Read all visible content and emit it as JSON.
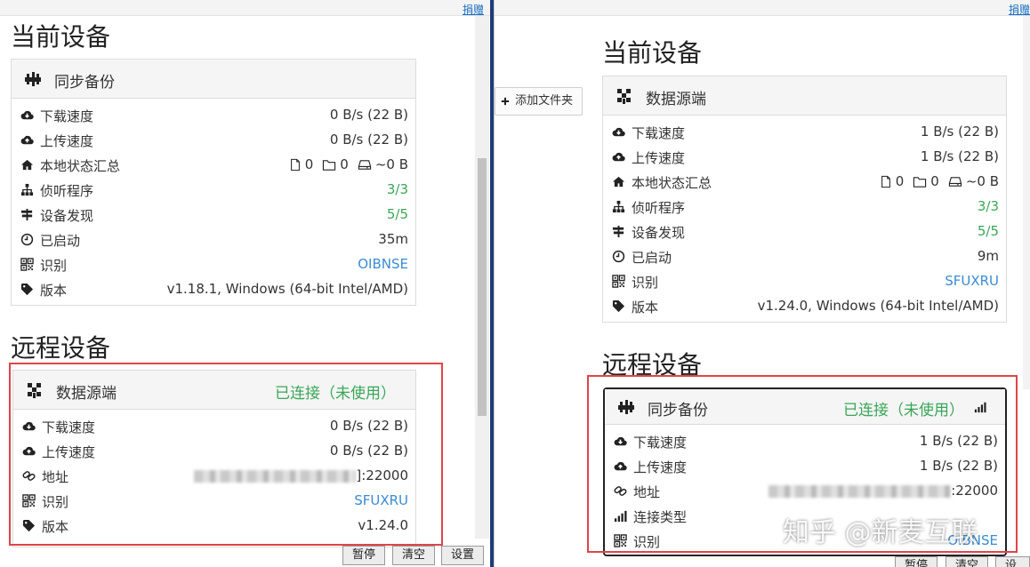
{
  "donate_label": "捐赠",
  "add_folder_label": "添加文件夹",
  "watermark": "知乎 @新麦互联",
  "bottom_buttons": {
    "pause": "暂停",
    "clear": "清空",
    "settings": "设置"
  },
  "left": {
    "current_title": "当前设备",
    "remote_title": "远程设备",
    "this_device": {
      "name": "同步备份",
      "rows": {
        "download": {
          "label": "下载速度",
          "value": "0 B/s (22 B)"
        },
        "upload": {
          "label": "上传速度",
          "value": "0 B/s (22 B)"
        },
        "local_state": {
          "label": "本地状态汇总",
          "files": "0",
          "dirs": "0",
          "size": "~0 B"
        },
        "listeners": {
          "label": "侦听程序",
          "value": "3/3"
        },
        "discovery": {
          "label": "设备发现",
          "value": "5/5"
        },
        "uptime": {
          "label": "已启动",
          "value": "35m"
        },
        "id": {
          "label": "识别",
          "value": "OIBNSE"
        },
        "version": {
          "label": "版本",
          "value": "v1.18.1, Windows (64-bit Intel/AMD)"
        }
      }
    },
    "remote_device": {
      "name": "数据源端",
      "status": "已连接（未使用）",
      "rows": {
        "download": {
          "label": "下载速度",
          "value": "0 B/s (22 B)"
        },
        "upload": {
          "label": "上传速度",
          "value": "0 B/s (22 B)"
        },
        "address": {
          "label": "地址",
          "value": "]:22000"
        },
        "id": {
          "label": "识别",
          "value": "SFUXRU"
        },
        "version": {
          "label": "版本",
          "value": "v1.24.0"
        }
      }
    }
  },
  "right": {
    "current_title": "当前设备",
    "remote_title": "远程设备",
    "this_device": {
      "name": "数据源端",
      "rows": {
        "download": {
          "label": "下载速度",
          "value": "1 B/s (22 B)"
        },
        "upload": {
          "label": "上传速度",
          "value": "1 B/s (22 B)"
        },
        "local_state": {
          "label": "本地状态汇总",
          "files": "0",
          "dirs": "0",
          "size": "~0 B"
        },
        "listeners": {
          "label": "侦听程序",
          "value": "3/3"
        },
        "discovery": {
          "label": "设备发现",
          "value": "5/5"
        },
        "uptime": {
          "label": "已启动",
          "value": "9m"
        },
        "id": {
          "label": "识别",
          "value": "SFUXRU"
        },
        "version": {
          "label": "版本",
          "value": "v1.24.0, Windows (64-bit Intel/AMD)"
        }
      }
    },
    "remote_device": {
      "name": "同步备份",
      "status": "已连接（未使用）",
      "rows": {
        "download": {
          "label": "下载速度",
          "value": "1 B/s (22 B)"
        },
        "upload": {
          "label": "上传速度",
          "value": "1 B/s (22 B)"
        },
        "address": {
          "label": "地址",
          "value": ":22000"
        },
        "conn_type": {
          "label": "连接类型",
          "value": ""
        },
        "id": {
          "label": "识别",
          "value": "OIBNSE"
        }
      }
    }
  }
}
